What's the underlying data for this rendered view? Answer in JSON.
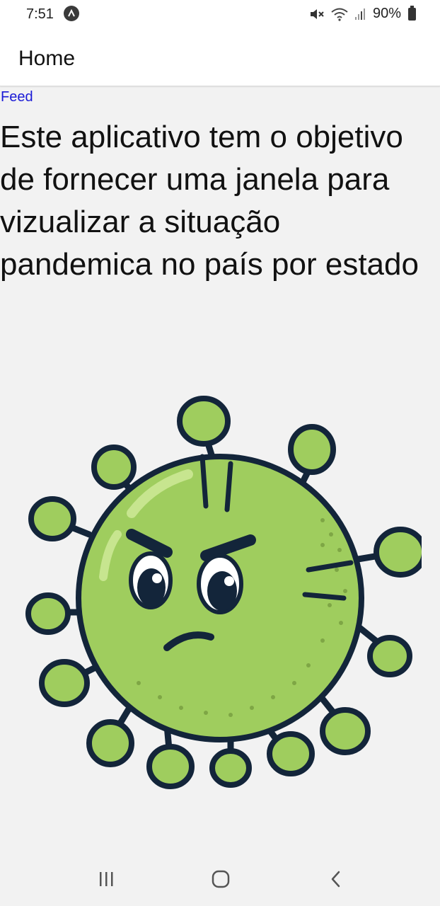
{
  "status_bar": {
    "time": "7:51",
    "battery": "90%",
    "icons": [
      "app-notification-icon",
      "mute-icon",
      "wifi-icon",
      "signal-icon",
      "battery-icon"
    ]
  },
  "header": {
    "title": "Home"
  },
  "feed_link": "Feed",
  "description": "Este aplicativo tem o objetivo de fornecer uma janela para vizualizar a situação pandemica no país por estado",
  "illustration": {
    "icon": "virus-illustration",
    "colors": {
      "body": "#9fcd5e",
      "outline": "#13253a",
      "highlight": "#c7e58f",
      "dots": "#7ea645"
    }
  },
  "nav_bar": {
    "buttons": [
      "recent-apps-icon",
      "home-icon",
      "back-icon"
    ]
  }
}
